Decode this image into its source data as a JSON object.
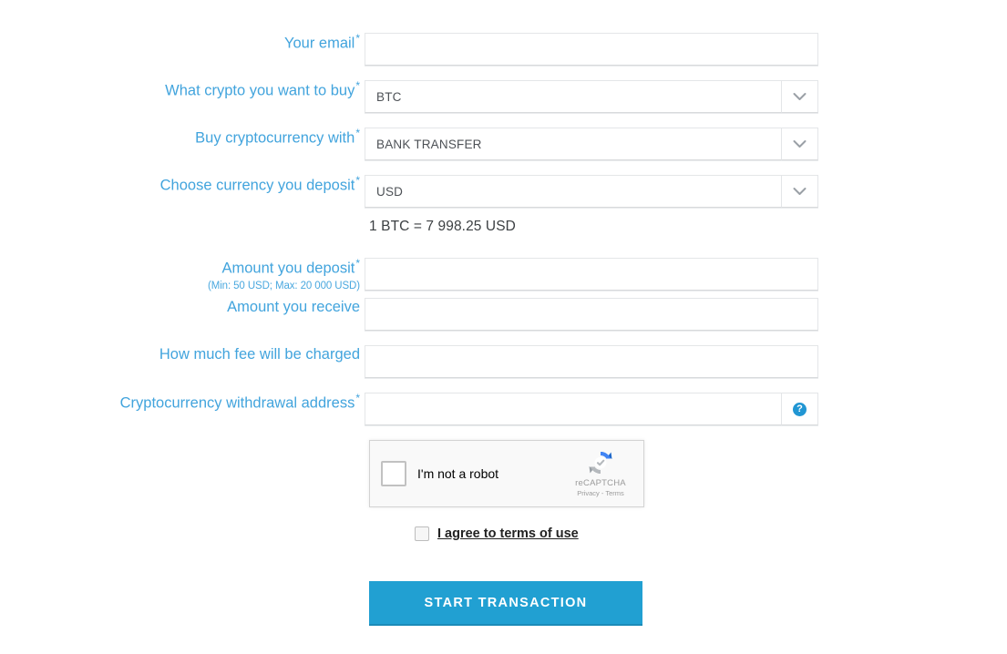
{
  "form": {
    "fields": [
      {
        "key": "email",
        "label": "Your email",
        "required": true,
        "type": "text",
        "value": "",
        "placeholder": ""
      },
      {
        "key": "crypto",
        "label": "What crypto you want to buy",
        "required": true,
        "type": "select",
        "value": "BTC",
        "options": [
          "BTC"
        ]
      },
      {
        "key": "payment_method",
        "label": "Buy cryptocurrency with",
        "required": true,
        "type": "select",
        "value": "BANK TRANSFER",
        "options": [
          "BANK TRANSFER"
        ]
      },
      {
        "key": "deposit_currency",
        "label": "Choose currency you deposit",
        "required": true,
        "type": "select",
        "value": "USD",
        "options": [
          "USD"
        ]
      },
      {
        "key": "amount_deposit",
        "label": "Amount you deposit",
        "hint": "(Min: 50 USD; Max: 20 000 USD)",
        "required": true,
        "type": "text",
        "value": "",
        "placeholder": ""
      },
      {
        "key": "amount_receive",
        "label": "Amount you receive",
        "required": false,
        "type": "text",
        "value": "",
        "placeholder": ""
      },
      {
        "key": "fee",
        "label": "How much fee will be charged",
        "required": false,
        "type": "text",
        "value": "",
        "placeholder": ""
      },
      {
        "key": "withdrawal_address",
        "label": "Cryptocurrency withdrawal address",
        "required": true,
        "type": "text-with-help",
        "value": "",
        "placeholder": ""
      }
    ],
    "required_marker": "*",
    "exchange_rate": "1 BTC = 7 998.25 USD",
    "help_icon_glyph": "?"
  },
  "recaptcha": {
    "checkbox_label": "I'm not a robot",
    "brand_name": "reCAPTCHA",
    "links": "Privacy - Terms",
    "checked": false
  },
  "terms": {
    "label": "I agree to terms of use",
    "checked": false
  },
  "submit": {
    "label": "START TRANSACTION"
  },
  "colors": {
    "label_blue": "#42a4dd",
    "button_blue": "#21a0d2",
    "help_icon_blue": "#2196d3",
    "text_dark": "#3c4043",
    "input_border": "#e4e6e8",
    "background": "#ffffff"
  }
}
